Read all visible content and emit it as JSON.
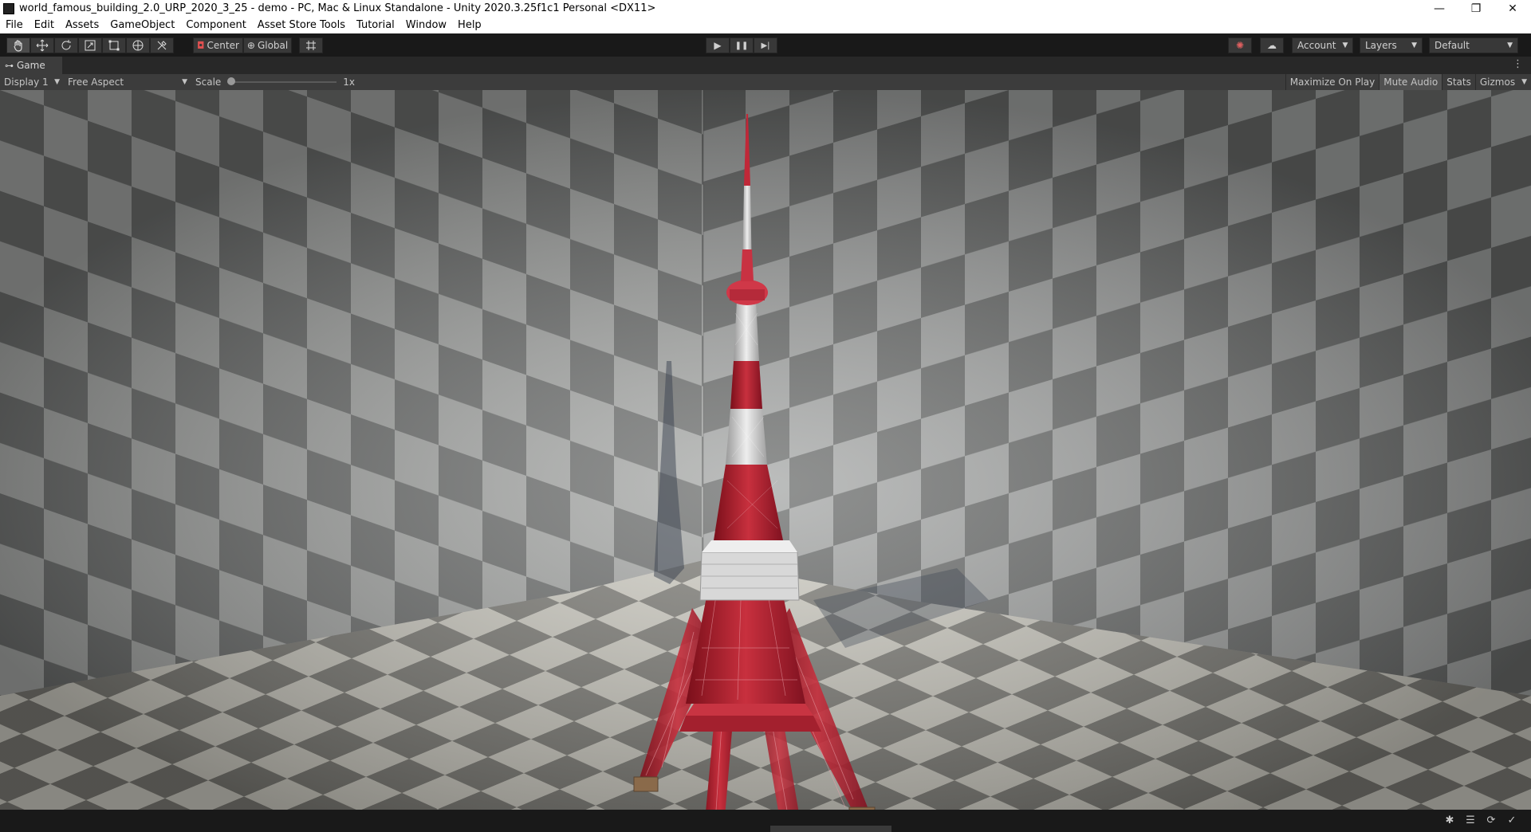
{
  "window": {
    "title": "world_famous_building_2.0_URP_2020_3_25 - demo - PC, Mac & Linux Standalone - Unity 2020.3.25f1c1 Personal <DX11>",
    "minimize": "—",
    "maximize": "❐",
    "close": "✕"
  },
  "menu": [
    "File",
    "Edit",
    "Assets",
    "GameObject",
    "Component",
    "Asset Store Tools",
    "Tutorial",
    "Window",
    "Help"
  ],
  "toolbar": {
    "tools": [
      "hand-icon",
      "move-icon",
      "rotate-icon",
      "scale-icon",
      "rect-icon",
      "transform-icon",
      "custom-tool-icon"
    ],
    "pivot_mode": "Center",
    "pivot_rotation": "Global",
    "play_icon": "▶",
    "pause_icon": "❚❚",
    "step_icon": "▶|",
    "account": "Account",
    "layers": "Layers",
    "layout": "Default"
  },
  "game_view": {
    "tab_label": "Game",
    "display": "Display 1",
    "aspect": "Free Aspect",
    "scale_label": "Scale",
    "scale_value": "1x",
    "scale_slider": 0,
    "maximize_on_play": "Maximize On Play",
    "mute_audio": "Mute Audio",
    "mute_audio_active": true,
    "stats": "Stats",
    "gizmos": "Gizmos"
  },
  "colors": {
    "editor_dark": "#191919",
    "panel": "#3c3c3c",
    "tower_red": "#b0202e",
    "tower_white": "#d8d8d8"
  }
}
